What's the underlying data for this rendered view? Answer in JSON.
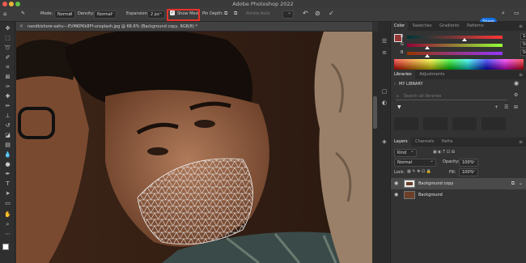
{
  "app_title": "Adobe Photoshop 2022",
  "options": {
    "mode_label": "Mode:",
    "mode_value": "Normal",
    "density_label": "Density:",
    "density_value": "Normal",
    "expansion_label": "Expansion:",
    "expansion_value": "2 px",
    "show_mesh_label": "Show Mesh",
    "pin_depth_label": "Pin Depth:",
    "rotate_label": "Rotate:",
    "rotate_value": "Auto",
    "share_label": "Share"
  },
  "document": {
    "tab_title": "nandkishore-sahu---EVMKPKk8Ff-unsplash.jpg @ 68.6% (Background copy, RGB/8) *"
  },
  "color_panel": {
    "tabs": [
      "Color",
      "Swatches",
      "Gradients",
      "Patterns"
    ],
    "sliders": [
      {
        "label": "R",
        "value": "149",
        "fraction": 0.58
      },
      {
        "label": "G",
        "value": "54",
        "fraction": 0.21
      },
      {
        "label": "B",
        "value": "54",
        "fraction": 0.21
      }
    ]
  },
  "libraries_panel": {
    "tabs": [
      "Libraries",
      "Adjustments"
    ],
    "library_name": "MY LIBRARY",
    "search_placeholder": "Search all libraries"
  },
  "layers_panel": {
    "tabs": [
      "Layers",
      "Channels",
      "Paths"
    ],
    "filter_kind": "Kind",
    "blend_mode": "Normal",
    "opacity_label": "Opacity:",
    "opacity_value": "100%",
    "lock_label": "Lock:",
    "fill_label": "Fill:",
    "fill_value": "100%",
    "layers": [
      {
        "name": "Background copy",
        "selected": true
      },
      {
        "name": "Background",
        "selected": false
      }
    ]
  }
}
